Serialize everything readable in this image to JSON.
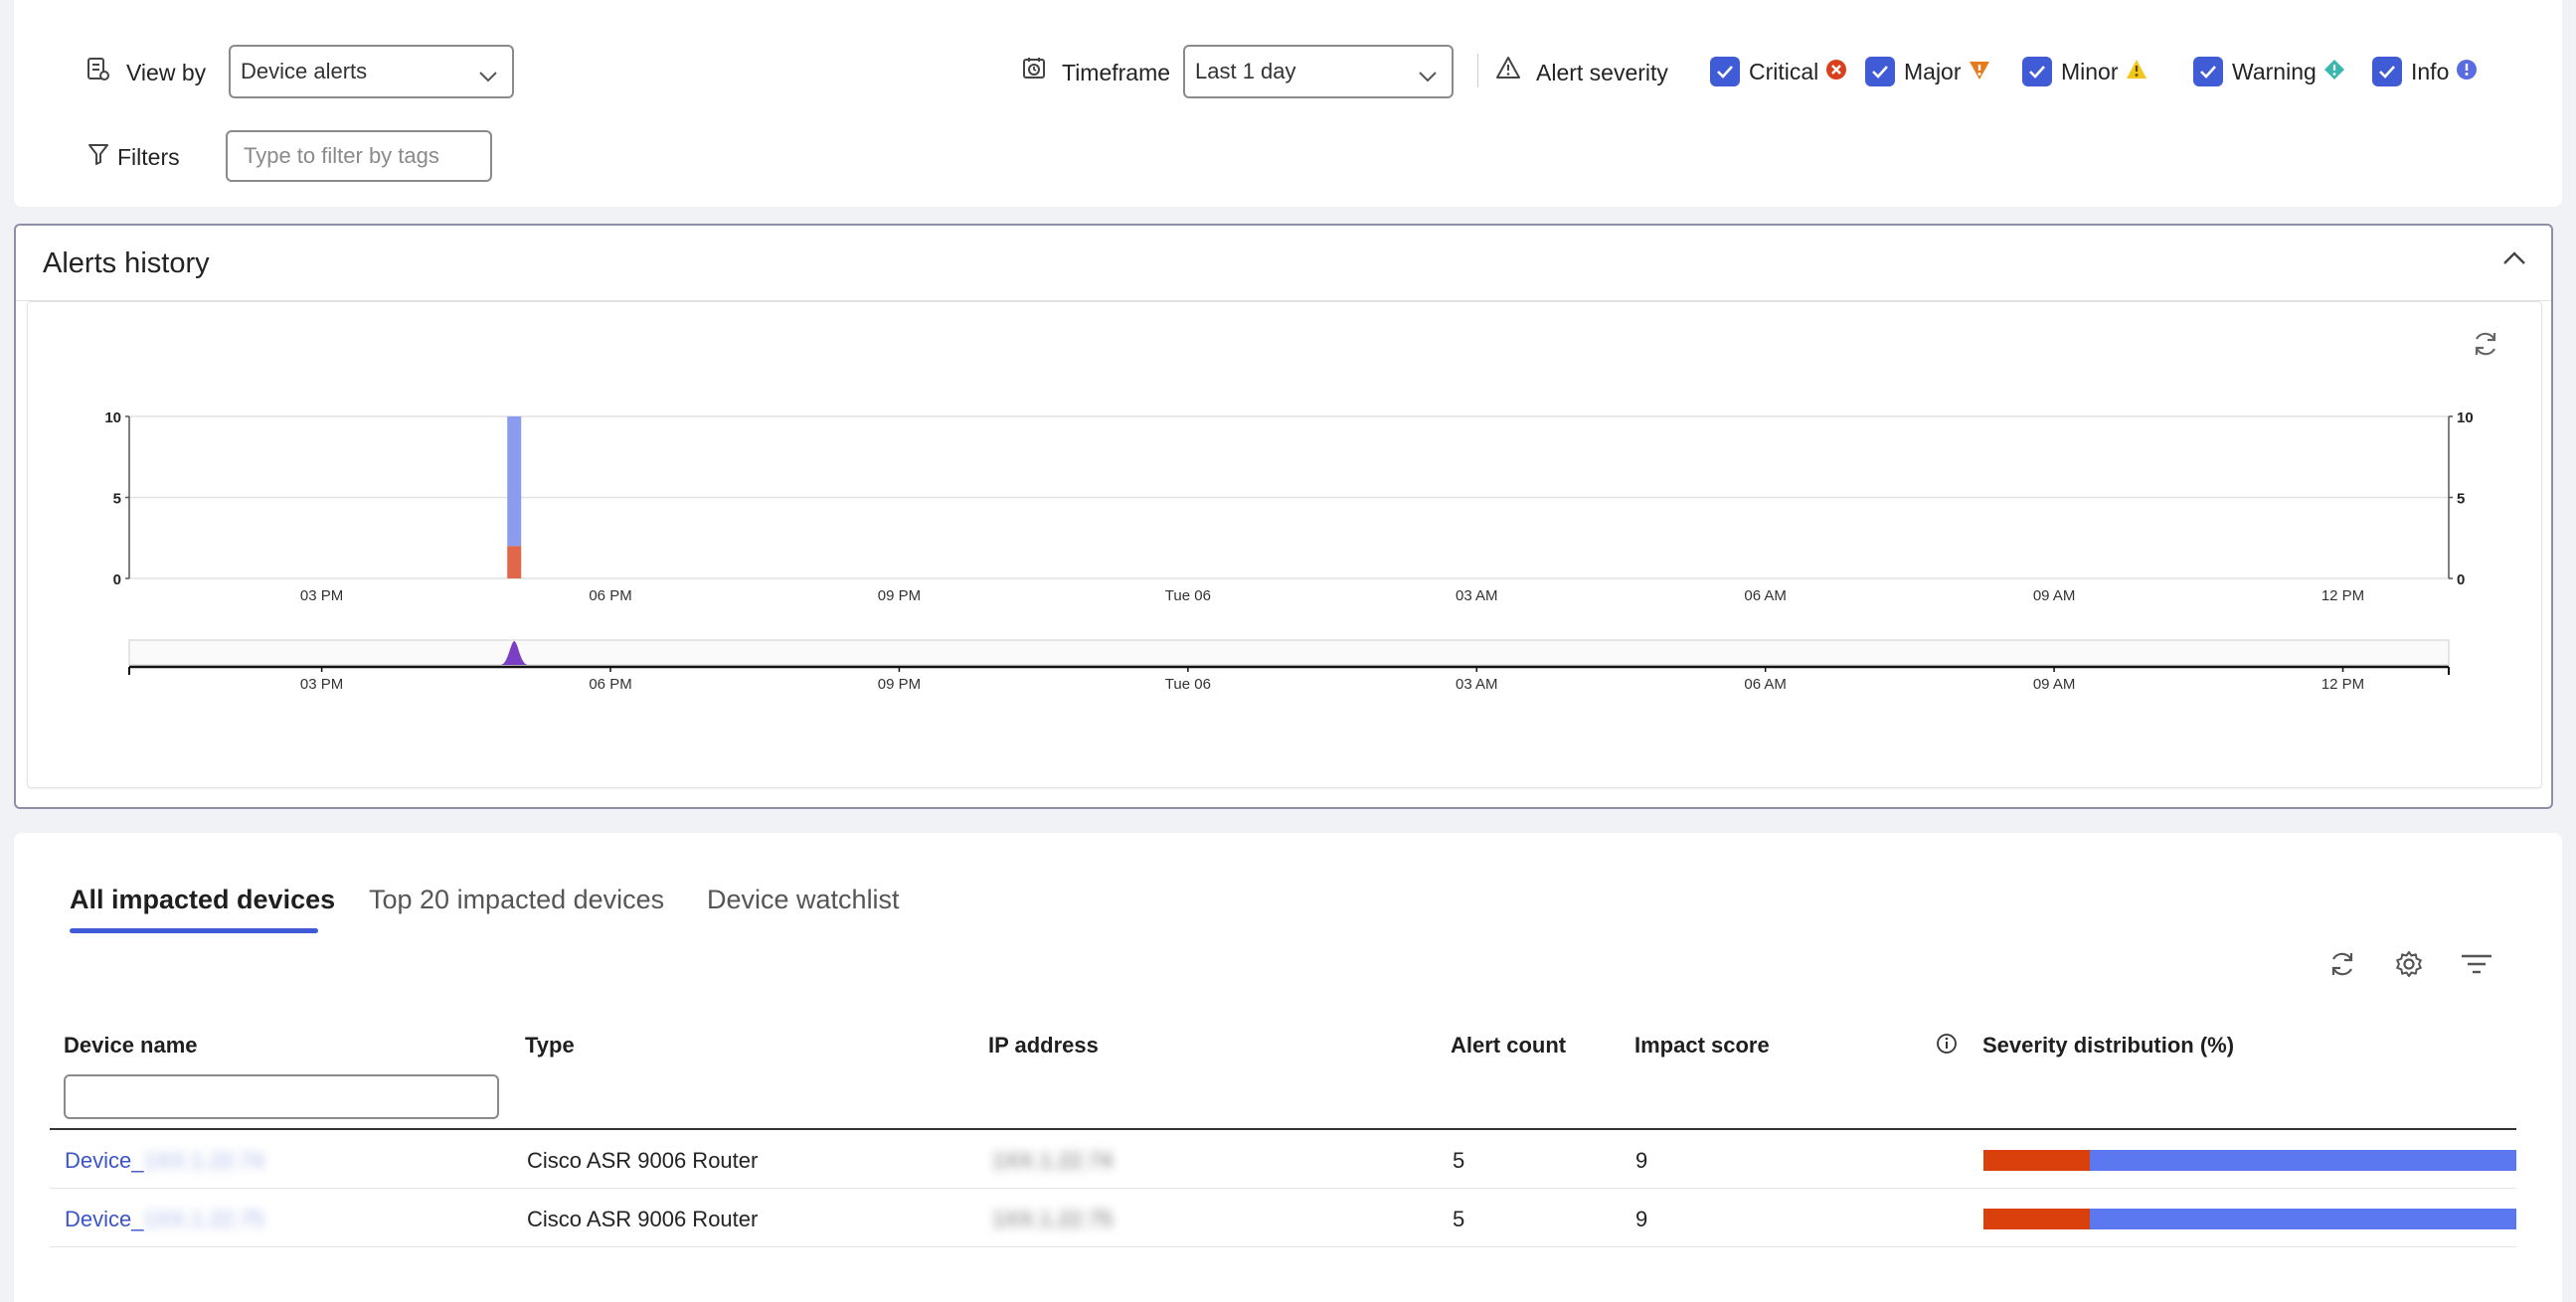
{
  "filters": {
    "view_by_label": "View by",
    "view_by_value": "Device alerts",
    "timeframe_label": "Timeframe",
    "timeframe_value": "Last 1 day",
    "alert_severity_label": "Alert severity",
    "filters_label": "Filters",
    "tags_placeholder": "Type to filter by tags",
    "severities": [
      {
        "label": "Critical",
        "checked": true,
        "color": "#d9411e",
        "icon": "critical-x-icon"
      },
      {
        "label": "Major",
        "checked": true,
        "color": "#e87a1e",
        "icon": "major-triangle-down-icon"
      },
      {
        "label": "Minor",
        "checked": true,
        "color": "#f2c718",
        "icon": "minor-warning-triangle-icon"
      },
      {
        "label": "Warning",
        "checked": true,
        "color": "#3ab7ae",
        "icon": "warning-diamond-icon"
      },
      {
        "label": "Info",
        "checked": true,
        "color": "#5a6de0",
        "icon": "info-circle-icon"
      }
    ]
  },
  "history": {
    "title": "Alerts history"
  },
  "chart_data": {
    "type": "bar",
    "stacked": true,
    "x_ticks": [
      "03 PM",
      "06 PM",
      "09 PM",
      "Tue 06",
      "03 AM",
      "06 AM",
      "09 AM",
      "12 PM"
    ],
    "y_ticks_left": [
      "0",
      "5",
      "10"
    ],
    "y_ticks_right": [
      "0",
      "5",
      "10"
    ],
    "ylim": [
      0,
      10
    ],
    "bars": [
      {
        "x": "05 PM",
        "series": [
          {
            "name": "Critical",
            "value": 2,
            "color": "#e0674a"
          },
          {
            "name": "Info",
            "value": 8,
            "color": "#8b9cef"
          }
        ]
      }
    ],
    "navigator": {
      "x_ticks": [
        "03 PM",
        "06 PM",
        "09 PM",
        "Tue 06",
        "03 AM",
        "06 AM",
        "09 AM",
        "12 PM"
      ],
      "peak_at": "05 PM",
      "peak_color": "#7a3fc4"
    },
    "grid": true
  },
  "tabs": [
    {
      "label": "All impacted devices",
      "active": true
    },
    {
      "label": "Top 20 impacted devices",
      "active": false
    },
    {
      "label": "Device watchlist",
      "active": false
    }
  ],
  "table": {
    "columns": [
      "Device name",
      "Type",
      "IP address",
      "Alert count",
      "Impact score",
      "Severity distribution (%)"
    ],
    "rows": [
      {
        "device_prefix": "Device_",
        "device_blurred": "1XX.1.22.74",
        "type": "Cisco ASR 9006 Router",
        "ip": "1XX.1.22.74",
        "alert_count": "5",
        "impact_score": "9",
        "dist": [
          {
            "name": "Critical",
            "fraction": 0.2,
            "color": "#d9400b"
          },
          {
            "name": "Info",
            "fraction": 0.8,
            "color": "#5b78f0"
          }
        ]
      },
      {
        "device_prefix": "Device_",
        "device_blurred": "1XX.1.22.75",
        "type": "Cisco ASR 9006 Router",
        "ip": "1XX.1.22.75",
        "alert_count": "5",
        "impact_score": "9",
        "dist": [
          {
            "name": "Critical",
            "fraction": 0.2,
            "color": "#d9400b"
          },
          {
            "name": "Info",
            "fraction": 0.8,
            "color": "#5b78f0"
          }
        ]
      }
    ]
  }
}
